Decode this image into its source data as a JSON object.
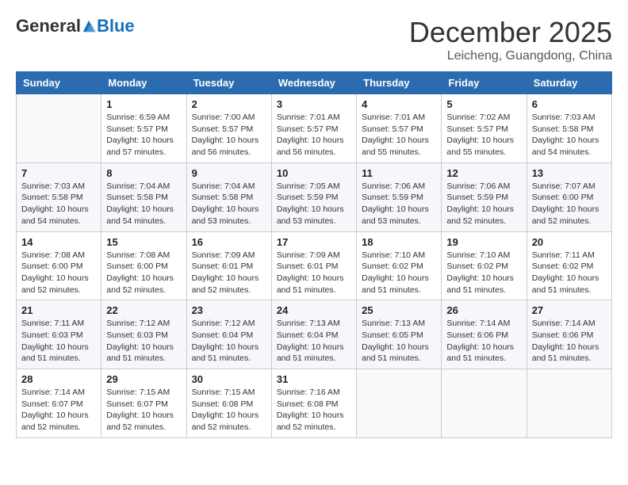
{
  "logo": {
    "general": "General",
    "blue": "Blue"
  },
  "title": "December 2025",
  "subtitle": "Leicheng, Guangdong, China",
  "headers": [
    "Sunday",
    "Monday",
    "Tuesday",
    "Wednesday",
    "Thursday",
    "Friday",
    "Saturday"
  ],
  "weeks": [
    [
      {
        "num": "",
        "info": ""
      },
      {
        "num": "1",
        "info": "Sunrise: 6:59 AM\nSunset: 5:57 PM\nDaylight: 10 hours\nand 57 minutes."
      },
      {
        "num": "2",
        "info": "Sunrise: 7:00 AM\nSunset: 5:57 PM\nDaylight: 10 hours\nand 56 minutes."
      },
      {
        "num": "3",
        "info": "Sunrise: 7:01 AM\nSunset: 5:57 PM\nDaylight: 10 hours\nand 56 minutes."
      },
      {
        "num": "4",
        "info": "Sunrise: 7:01 AM\nSunset: 5:57 PM\nDaylight: 10 hours\nand 55 minutes."
      },
      {
        "num": "5",
        "info": "Sunrise: 7:02 AM\nSunset: 5:57 PM\nDaylight: 10 hours\nand 55 minutes."
      },
      {
        "num": "6",
        "info": "Sunrise: 7:03 AM\nSunset: 5:58 PM\nDaylight: 10 hours\nand 54 minutes."
      }
    ],
    [
      {
        "num": "7",
        "info": "Sunrise: 7:03 AM\nSunset: 5:58 PM\nDaylight: 10 hours\nand 54 minutes."
      },
      {
        "num": "8",
        "info": "Sunrise: 7:04 AM\nSunset: 5:58 PM\nDaylight: 10 hours\nand 54 minutes."
      },
      {
        "num": "9",
        "info": "Sunrise: 7:04 AM\nSunset: 5:58 PM\nDaylight: 10 hours\nand 53 minutes."
      },
      {
        "num": "10",
        "info": "Sunrise: 7:05 AM\nSunset: 5:59 PM\nDaylight: 10 hours\nand 53 minutes."
      },
      {
        "num": "11",
        "info": "Sunrise: 7:06 AM\nSunset: 5:59 PM\nDaylight: 10 hours\nand 53 minutes."
      },
      {
        "num": "12",
        "info": "Sunrise: 7:06 AM\nSunset: 5:59 PM\nDaylight: 10 hours\nand 52 minutes."
      },
      {
        "num": "13",
        "info": "Sunrise: 7:07 AM\nSunset: 6:00 PM\nDaylight: 10 hours\nand 52 minutes."
      }
    ],
    [
      {
        "num": "14",
        "info": "Sunrise: 7:08 AM\nSunset: 6:00 PM\nDaylight: 10 hours\nand 52 minutes."
      },
      {
        "num": "15",
        "info": "Sunrise: 7:08 AM\nSunset: 6:00 PM\nDaylight: 10 hours\nand 52 minutes."
      },
      {
        "num": "16",
        "info": "Sunrise: 7:09 AM\nSunset: 6:01 PM\nDaylight: 10 hours\nand 52 minutes."
      },
      {
        "num": "17",
        "info": "Sunrise: 7:09 AM\nSunset: 6:01 PM\nDaylight: 10 hours\nand 51 minutes."
      },
      {
        "num": "18",
        "info": "Sunrise: 7:10 AM\nSunset: 6:02 PM\nDaylight: 10 hours\nand 51 minutes."
      },
      {
        "num": "19",
        "info": "Sunrise: 7:10 AM\nSunset: 6:02 PM\nDaylight: 10 hours\nand 51 minutes."
      },
      {
        "num": "20",
        "info": "Sunrise: 7:11 AM\nSunset: 6:02 PM\nDaylight: 10 hours\nand 51 minutes."
      }
    ],
    [
      {
        "num": "21",
        "info": "Sunrise: 7:11 AM\nSunset: 6:03 PM\nDaylight: 10 hours\nand 51 minutes."
      },
      {
        "num": "22",
        "info": "Sunrise: 7:12 AM\nSunset: 6:03 PM\nDaylight: 10 hours\nand 51 minutes."
      },
      {
        "num": "23",
        "info": "Sunrise: 7:12 AM\nSunset: 6:04 PM\nDaylight: 10 hours\nand 51 minutes."
      },
      {
        "num": "24",
        "info": "Sunrise: 7:13 AM\nSunset: 6:04 PM\nDaylight: 10 hours\nand 51 minutes."
      },
      {
        "num": "25",
        "info": "Sunrise: 7:13 AM\nSunset: 6:05 PM\nDaylight: 10 hours\nand 51 minutes."
      },
      {
        "num": "26",
        "info": "Sunrise: 7:14 AM\nSunset: 6:06 PM\nDaylight: 10 hours\nand 51 minutes."
      },
      {
        "num": "27",
        "info": "Sunrise: 7:14 AM\nSunset: 6:06 PM\nDaylight: 10 hours\nand 51 minutes."
      }
    ],
    [
      {
        "num": "28",
        "info": "Sunrise: 7:14 AM\nSunset: 6:07 PM\nDaylight: 10 hours\nand 52 minutes."
      },
      {
        "num": "29",
        "info": "Sunrise: 7:15 AM\nSunset: 6:07 PM\nDaylight: 10 hours\nand 52 minutes."
      },
      {
        "num": "30",
        "info": "Sunrise: 7:15 AM\nSunset: 6:08 PM\nDaylight: 10 hours\nand 52 minutes."
      },
      {
        "num": "31",
        "info": "Sunrise: 7:16 AM\nSunset: 6:08 PM\nDaylight: 10 hours\nand 52 minutes."
      },
      {
        "num": "",
        "info": ""
      },
      {
        "num": "",
        "info": ""
      },
      {
        "num": "",
        "info": ""
      }
    ]
  ]
}
